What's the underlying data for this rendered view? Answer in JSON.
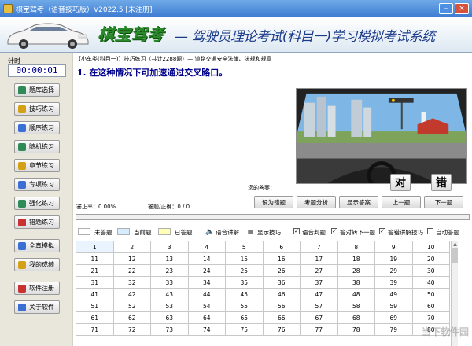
{
  "window": {
    "title": "棋宝驾考（语音技巧版）V2022.5 [未注册]"
  },
  "header": {
    "brand": "棋宝驾考",
    "slogan": "— 驾驶员理论考试(科目一)学习模拟考试系统"
  },
  "sidebar": {
    "timer_label": "计时",
    "timer_value": "00:00:01",
    "buttons": [
      {
        "label": "题库选择",
        "color": "#2e8b57"
      },
      {
        "label": "技巧练习",
        "color": "#d4a017"
      },
      {
        "label": "顺序练习",
        "color": "#3b6fd4"
      },
      {
        "label": "随机练习",
        "color": "#2e8b57"
      },
      {
        "label": "章节练习",
        "color": "#d4a017"
      },
      {
        "label": "专项练习",
        "color": "#3b6fd4"
      },
      {
        "label": "强化练习",
        "color": "#2e8b57"
      },
      {
        "label": "错题练习",
        "color": "#c83232"
      },
      {
        "label": "全真模拟",
        "color": "#3b6fd4"
      },
      {
        "label": "我的成绩",
        "color": "#d4a017"
      },
      {
        "label": "软件注册",
        "color": "#c83232"
      },
      {
        "label": "关于软件",
        "color": "#3b6fd4"
      }
    ]
  },
  "main": {
    "breadcrumb": "【小车类(科目一)】技巧练习（共计2288题）— 道路交通安全法律、法规和规章",
    "question": "1. 在这种情况下可加速通过交叉路口。",
    "answer_label": "您的答案：",
    "true_label": "对",
    "false_label": "错",
    "accuracy_text": "答正率：0.00%",
    "ratio_text": "答题/正确：0 / 0",
    "actions": [
      "设为错题",
      "考题分析",
      "显示答案",
      "上一题",
      "下一题"
    ]
  },
  "legend": {
    "unanswered": "未答题",
    "current": "当前题",
    "answered": "已答题",
    "voice_explain": "语音讲解",
    "show_tips": "显示技巧",
    "voice_judge": "语音判题",
    "auto_next": "答对转下一题",
    "wrong_explain": "答错讲解技巧",
    "auto_answer": "自动答题"
  },
  "grid": {
    "rows": [
      [
        "1",
        "2",
        "3",
        "4",
        "5",
        "6",
        "7",
        "8",
        "9",
        "10"
      ],
      [
        "11",
        "12",
        "13",
        "14",
        "15",
        "16",
        "17",
        "18",
        "19",
        "20"
      ],
      [
        "21",
        "22",
        "23",
        "24",
        "25",
        "26",
        "27",
        "28",
        "29",
        "30"
      ],
      [
        "31",
        "32",
        "33",
        "34",
        "35",
        "36",
        "37",
        "38",
        "39",
        "40"
      ],
      [
        "41",
        "42",
        "43",
        "44",
        "45",
        "46",
        "47",
        "48",
        "49",
        "50"
      ],
      [
        "51",
        "52",
        "53",
        "54",
        "55",
        "56",
        "57",
        "58",
        "59",
        "60"
      ],
      [
        "61",
        "62",
        "63",
        "64",
        "65",
        "66",
        "67",
        "68",
        "69",
        "70"
      ],
      [
        "71",
        "72",
        "73",
        "74",
        "75",
        "76",
        "77",
        "78",
        "79",
        "80"
      ]
    ]
  },
  "watermark": "当下软件园"
}
